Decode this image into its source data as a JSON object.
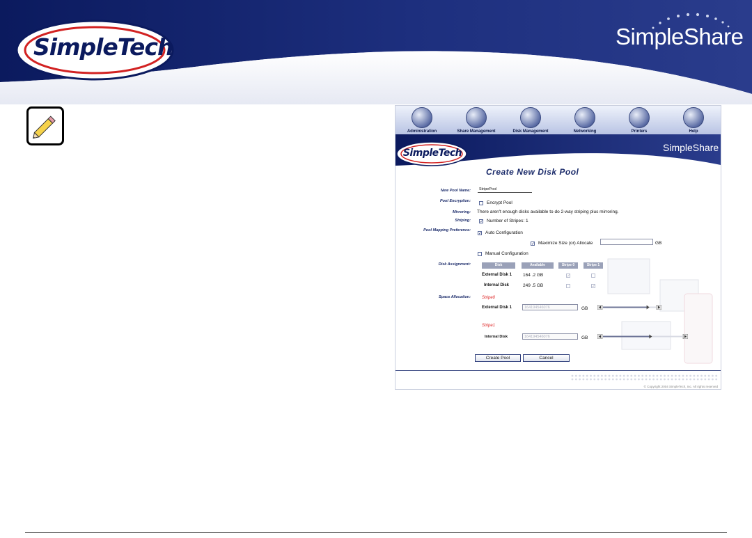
{
  "header": {
    "logo_text": "SimpleTech",
    "product_text": "SimpleShare"
  },
  "note_icon": "pencil-note-icon",
  "screenshot": {
    "nav": [
      {
        "label": "Administration",
        "icon": "administration-icon"
      },
      {
        "label": "Share Management",
        "icon": "share-management-icon"
      },
      {
        "label": "Disk Management",
        "icon": "disk-management-icon"
      },
      {
        "label": "Networking",
        "icon": "networking-icon"
      },
      {
        "label": "Printers",
        "icon": "printers-icon"
      },
      {
        "label": "Help",
        "icon": "help-icon"
      }
    ],
    "logo_text": "SimpleTech",
    "product_text": "SimpleShare",
    "title": "Create New Disk Pool",
    "labels": {
      "pool_name": "New Pool Name:",
      "encryption": "Pool Encryption:",
      "mirroring": "Mirroring:",
      "striping": "Striping:",
      "mapping": "Pool Mapping Preference:",
      "disk_assignment": "Disk Assignment:",
      "space_allocation": "Space Allocation:"
    },
    "pool_name_value": "StripePool",
    "encrypt_label": "Encrypt Pool",
    "encrypt_checked": false,
    "mirroring_text": "There aren't enough disks available to do 2-way striping plus mirroring.",
    "stripes_label": "Number of Stripes: 1",
    "stripes_checked": true,
    "auto_config_label": "Auto Configuration",
    "auto_config_checked": true,
    "maximize_label": "Maximize Size (or) Allocate",
    "maximize_checked": true,
    "allocate_value": "",
    "allocate_unit": "GB",
    "manual_config_label": "Manual Configuration",
    "manual_config_checked": false,
    "disk_table": {
      "headers": [
        "Disk",
        "Available",
        "Stripe 0",
        "Stripe 1"
      ],
      "rows": [
        {
          "disk": "External Disk 1",
          "available": "164 .2 GB",
          "stripe0": true,
          "stripe1": false
        },
        {
          "disk": "Internal Disk",
          "available": "249 .5 GB",
          "stripe0": false,
          "stripe1": true
        }
      ]
    },
    "allocations": [
      {
        "stripe": "Stripe0",
        "disk": "External Disk 1",
        "value": "164194546076",
        "unit": "GB",
        "level": 0.85
      },
      {
        "stripe": "Stripe1",
        "disk": "Internal Disk",
        "value": "164194546076",
        "unit": "GB",
        "level": 0.6
      }
    ],
    "buttons": {
      "create": "Create Pool",
      "cancel": "Cancel"
    },
    "copyright": "© Copyright 2004 SimpleTech, Inc. All rights reserved"
  },
  "colors": {
    "banner_dark": "#0b1a5e",
    "banner_mid": "#2a3c8c",
    "accent_red": "#d22222",
    "text_navy": "#1b2b6a"
  }
}
